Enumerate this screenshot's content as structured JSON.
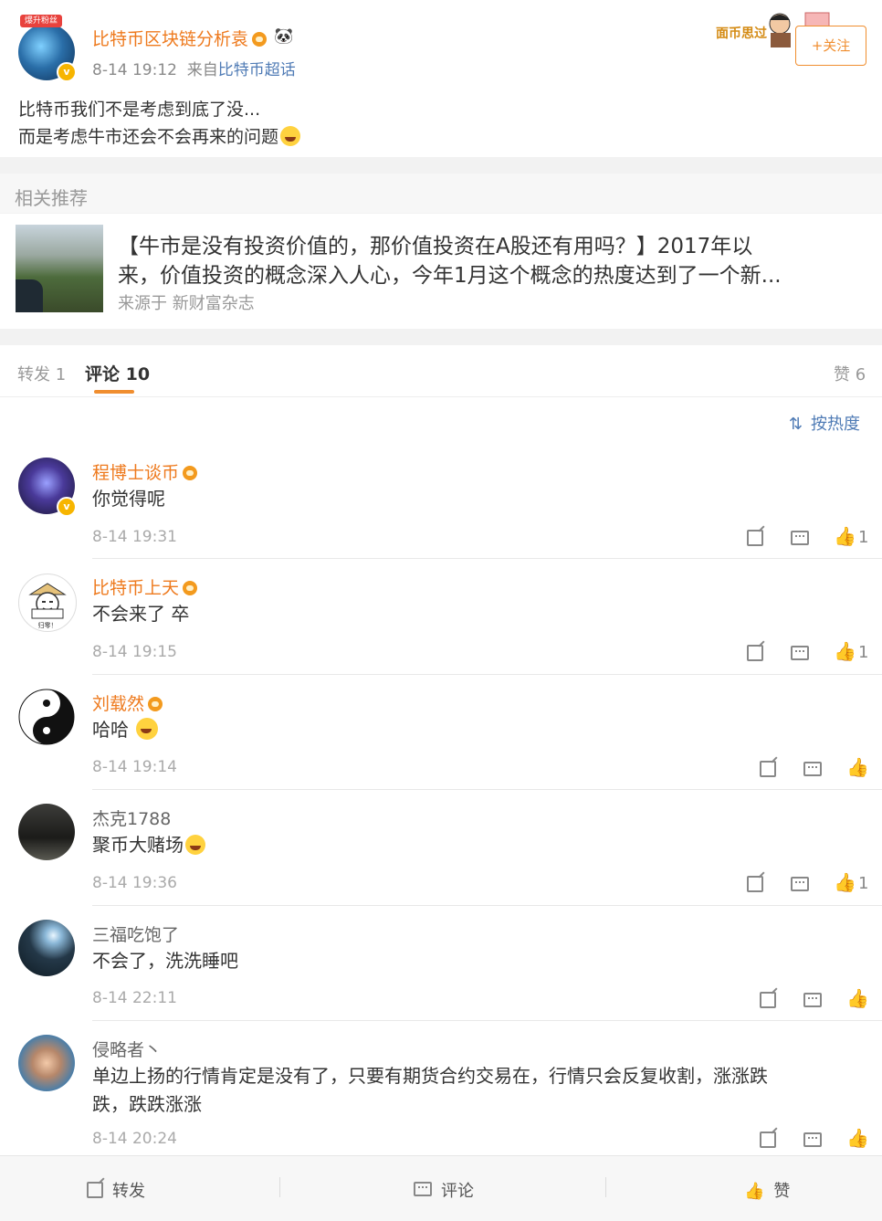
{
  "post": {
    "top_badge": "爆升粉丝",
    "author": "比特币区块链分析袁",
    "time": "8-14 19:12",
    "from_prefix": "来自",
    "from_source": "比特币超话",
    "follow_label": "+关注",
    "deco_text": "面币思过",
    "line1": "比特币我们不是考虑到底了没...",
    "line2": "而是考虑牛市还会不会再来的问题"
  },
  "related": {
    "header": "相关推荐",
    "line1": "【牛市是没有投资价值的，那价值投资在A股还有用吗？】2017年以",
    "line2": "来，价值投资的概念深入人心，今年1月这个概念的热度达到了一个新...",
    "source": "来源于 新财富杂志"
  },
  "tabs": {
    "repost": "转发 1",
    "comment": "评论 10",
    "like": "赞 6"
  },
  "sort_label": "按热度",
  "comments": [
    {
      "name": "程博士谈币",
      "text": "你觉得呢",
      "time": "8-14 19:31",
      "likes": "1"
    },
    {
      "name": "比特币上天",
      "text": "不会来了 卒",
      "time": "8-14 19:15",
      "likes": "1"
    },
    {
      "name": "刘载然",
      "text": "哈哈",
      "time": "8-14 19:14",
      "likes": ""
    },
    {
      "name": "杰克1788",
      "text": "聚币大赌场",
      "time": "8-14 19:36",
      "likes": "1"
    },
    {
      "name": "三福吃饱了",
      "text": "不会了，洗洗睡吧",
      "time": "8-14 22:11",
      "likes": ""
    },
    {
      "name": "侵略者丶",
      "text": "单边上扬的行情肯定是没有了，只要有期货合约交易在，行情只会反复收割，涨涨跌",
      "text2": "跌，跌跌涨涨",
      "time": "8-14 20:24",
      "likes": ""
    }
  ],
  "avatar2_caption": "归零！",
  "bottom": {
    "repost": "转发",
    "comment": "评论",
    "like": "赞"
  }
}
